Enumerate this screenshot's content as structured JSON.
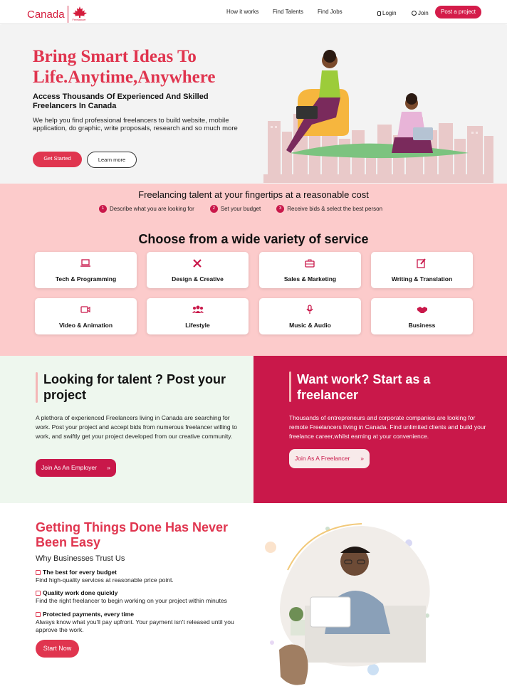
{
  "nav": {
    "brand": "Canada",
    "brand_sub": "Freelancer",
    "links": [
      "How it works",
      "Find Talents",
      "Find Jobs"
    ],
    "login": "Login",
    "join": "Join",
    "post": "Post a project"
  },
  "hero": {
    "title": "Bring Smart Ideas To Life.Anytime,Anywhere",
    "subtitle": "Access Thousands Of Experienced And Skilled Freelancers In Canada",
    "description": "We help you find professional freelancers to build website, mobile application, do graphic, write proposals, research and so much more",
    "get_started": "Get Started",
    "learn_more": "Learn more"
  },
  "steps": {
    "title": "Freelancing talent at your fingertips at a reasonable cost",
    "items": [
      {
        "num": "1",
        "label": "Describe what you are looking for"
      },
      {
        "num": "2",
        "label": "Set your budget"
      },
      {
        "num": "3",
        "label": "Receive bids & select the best person"
      }
    ]
  },
  "services": {
    "title": "Choose from a wide variety of service",
    "items": [
      {
        "label": "Tech & Programming",
        "icon": "laptop-icon"
      },
      {
        "label": "Design & Creative",
        "icon": "design-tools-icon"
      },
      {
        "label": "Sales & Marketing",
        "icon": "briefcase-icon"
      },
      {
        "label": "Writing & Translation",
        "icon": "edit-icon"
      },
      {
        "label": "Video & Animation",
        "icon": "video-icon"
      },
      {
        "label": "Lifestyle",
        "icon": "people-icon"
      },
      {
        "label": "Music & Audio",
        "icon": "microphone-icon"
      },
      {
        "label": "Business",
        "icon": "handshake-icon"
      }
    ]
  },
  "employer": {
    "title": "Looking for talent ? Post your project",
    "description": "A plethora of experienced Freelancers living in Canada are searching for work. Post your project and accept bids from numerous freelancer willing to work, and swiftly get your project developed from our creative community.",
    "button": "Join As An Employer"
  },
  "freelancer": {
    "title": "Want work? Start as a freelancer",
    "description": "Thousands of entrepreneurs and corporate companies are looking for remote Freelancers living in Canada. Find unlimited clients and build your freelance career,whilst earning at your convenience.",
    "button": "Join As A Freelancer"
  },
  "trust": {
    "title": "Getting Things Done Has Never Been Easy",
    "subtitle": "Why Businesses Trust Us",
    "features": [
      {
        "title": "The best for every budget",
        "text": "Find high-quality services at reasonable price point."
      },
      {
        "title": "Quality work done quickly",
        "text": "Find the right freelancer to begin working on your project within minutes"
      },
      {
        "title": "Protected payments, every time",
        "text": "Always know what you'll pay upfront. Your payment isn't released until you approve the work."
      }
    ],
    "button": "Start Now"
  },
  "colors": {
    "accent": "#e0354f",
    "brand": "#c9184a",
    "pink_bg": "#fccbcb",
    "mint_bg": "#eef7ee"
  }
}
